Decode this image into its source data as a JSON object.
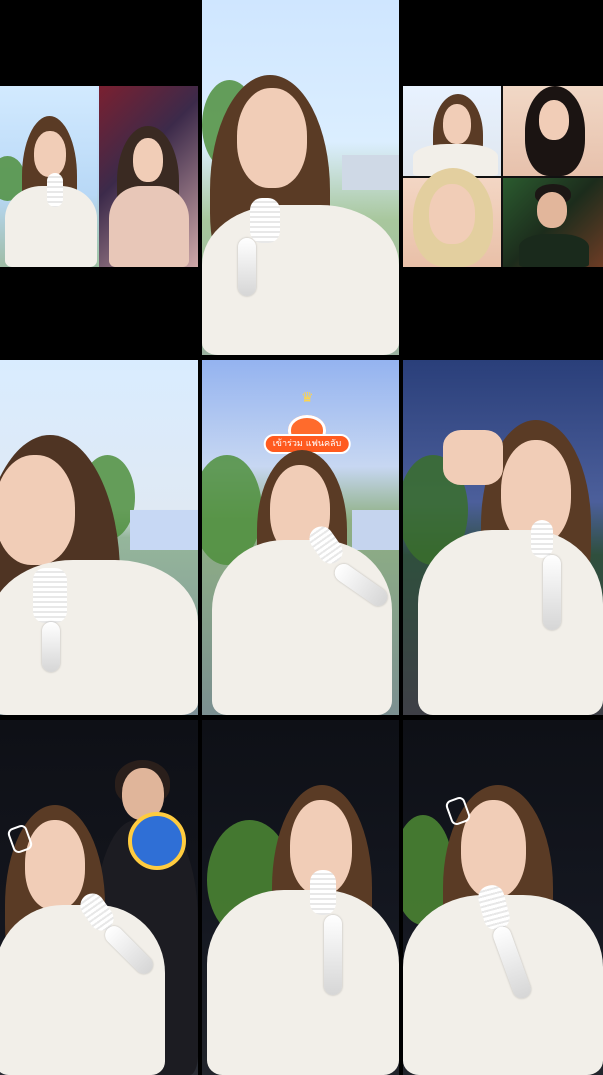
{
  "overlay": {
    "sticker_label": "เข้าร่วม แฟนคลับ"
  },
  "colors": {
    "sticker_orange": "#ff5a1f",
    "night_bg": "#0e1016",
    "sky_day": "#bfe0ff",
    "sky_dusk": "#6c7fb1"
  },
  "icons": {
    "sticker": "fanclub-sticker-icon",
    "microphone": "microphone-icon",
    "hairclip": "hairclip-icon"
  }
}
